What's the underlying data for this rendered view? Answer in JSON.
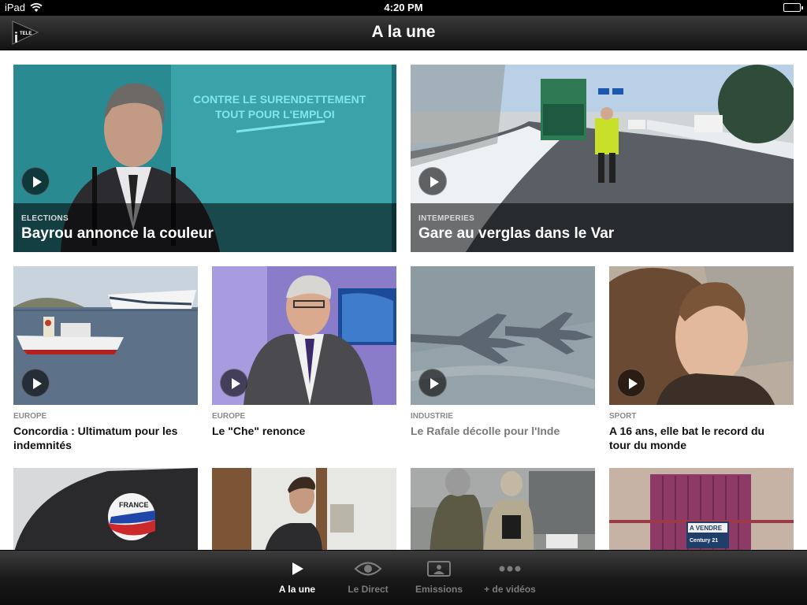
{
  "status_bar": {
    "device": "iPad",
    "time": "4:20 PM"
  },
  "nav": {
    "title": "A la une",
    "logo_text": "TELE"
  },
  "featured": [
    {
      "category": "ELECTIONS",
      "headline": "Bayrou annonce la couleur",
      "screen_text_1": "CONTRE LE SURENDETTEMENT",
      "screen_text_2": "TOUT POUR L'EMPLOI"
    },
    {
      "category": "INTEMPERIES",
      "headline": "Gare au verglas dans le Var"
    }
  ],
  "stories": [
    {
      "category": "EUROPE",
      "headline": "Concordia : Ultimatum pour les indemnités"
    },
    {
      "category": "EUROPE",
      "headline": "Le \"Che\" renonce"
    },
    {
      "category": "INDUSTRIE",
      "headline": "Le Rafale décolle pour l'Inde"
    },
    {
      "category": "SPORT",
      "headline": "A 16 ans, elle bat le record du tour du monde"
    }
  ],
  "row3": {
    "sticker_text": "Fabriqué en FRANCE",
    "sign_text_1": "A VENDRE",
    "sign_text_2": "Century 21"
  },
  "tabs": [
    {
      "label": "A la une",
      "icon": "play-icon",
      "active": true
    },
    {
      "label": "Le Direct",
      "icon": "eye-icon",
      "active": false
    },
    {
      "label": "Emissions",
      "icon": "tv-icon",
      "active": false
    },
    {
      "label": "+ de vidéos",
      "icon": "more-dots-icon",
      "active": false
    }
  ],
  "colors": {
    "tab_active": "#ffffff",
    "tab_inactive": "#7c7c7c",
    "nav_bg": "#222222",
    "category_gray": "#8a8a8a"
  }
}
